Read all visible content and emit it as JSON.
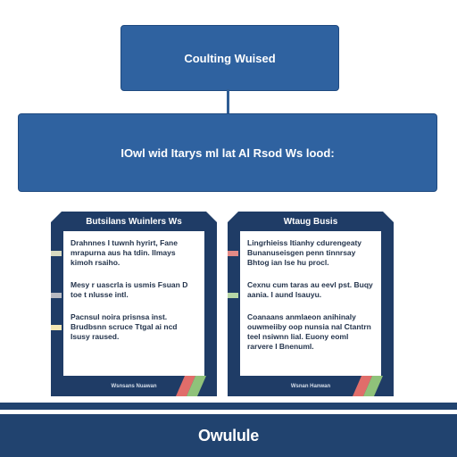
{
  "diagram": {
    "top_box": {
      "label": "Coulting Wuised"
    },
    "banner": {
      "label": "IOwl wid Itarys ml lat Al Rsod Ws lood:"
    },
    "cards": [
      {
        "title": "Butsilans Wuinlers Ws",
        "paragraphs": [
          "Drahnnes I tuwnh hyrirt, Fane mrapurna aus ha tdin. Ilmays kimoh rsaiho.",
          "Mesy r uascrla is usmis Fsuan D toe t nlusse intl.",
          "Pacnsul noira prisnsa inst. Brudbsnn scruce Ttgal ai ncd Isusy raused."
        ],
        "marker_colors": [
          "#d8dac0",
          "#b9bbc2",
          "#f4e7b4"
        ],
        "footer": "Wsnsans Nuawan"
      },
      {
        "title": "Wtaug Busis",
        "paragraphs": [
          "Lingrhieiss Itianhy cdurengeaty Bunanuseisgen penn tinnrsay Bhtog ian lse hu procl.",
          "Cexnu cum taras au eevl pst. Buqy aania. I aund lsauyu.",
          "Coanaans anmlaeon anihinaly ouwmeiiby oop nunsia nal Ctantrn teel nsiwnn lial. Euony eoml rarvere I Bnenuml."
        ],
        "marker_colors": [
          "#e38a86",
          "#b7d7a6"
        ],
        "footer": "Wsnan Hanwan"
      }
    ],
    "logo": "Owulule",
    "colors": {
      "primary": "#2f62a0",
      "card_navy": "#1f3c66",
      "bar_navy": "#21436f",
      "stripe_red": "#e06d6a",
      "stripe_green": "#8fc27a"
    }
  }
}
